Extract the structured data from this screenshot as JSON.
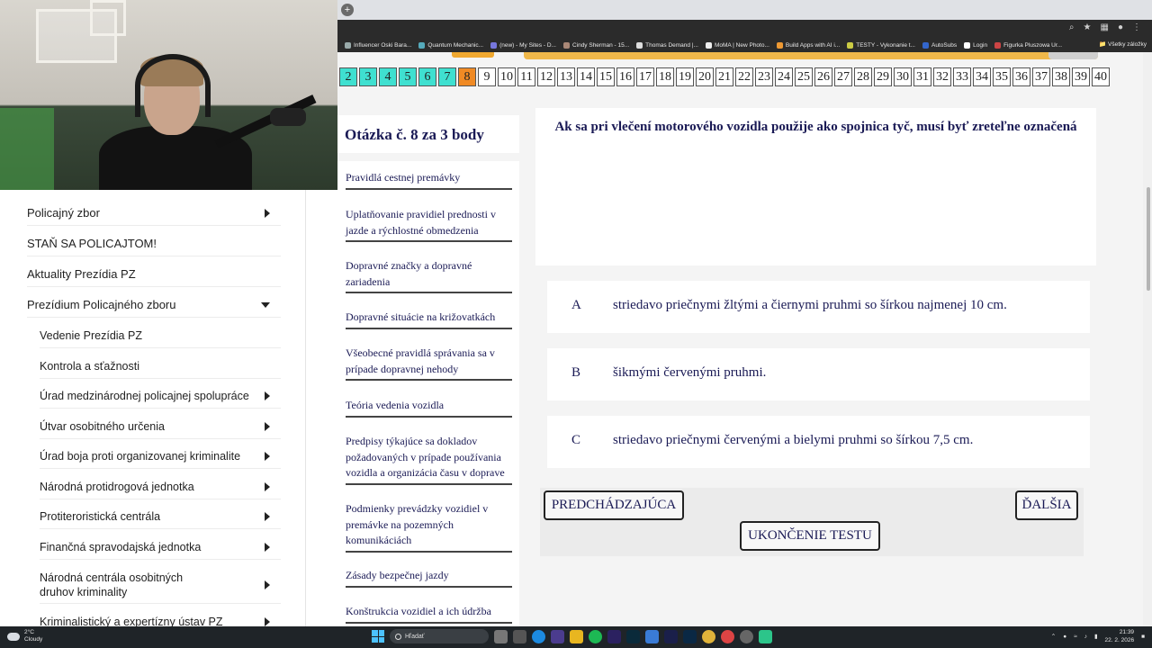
{
  "sidebar": {
    "items": [
      {
        "label": "Policajný zbor",
        "arrow": "right"
      },
      {
        "label": "STAŇ SA POLICAJTOM!",
        "arrow": ""
      },
      {
        "label": "Aktuality Prezídia PZ",
        "arrow": ""
      },
      {
        "label": "Prezídium Policajného zboru",
        "arrow": "down"
      },
      {
        "label": "Vedenie Prezídia PZ",
        "arrow": ""
      },
      {
        "label": "Kontrola a sťažnosti",
        "arrow": ""
      },
      {
        "label": "Úrad medzinárodnej policajnej spolupráce",
        "arrow": "right"
      },
      {
        "label": "Útvar osobitného určenia",
        "arrow": "right"
      },
      {
        "label": "Úrad boja proti organizovanej kriminalite",
        "arrow": "right"
      },
      {
        "label": "Národná protidrogová jednotka",
        "arrow": "right"
      },
      {
        "label": "Protiteroristická centrála",
        "arrow": "right"
      },
      {
        "label": "Finančná spravodajská jednotka",
        "arrow": "right"
      },
      {
        "label": "Národná centrála osobitných druhov kriminality",
        "arrow": "right"
      },
      {
        "label": "Kriminalistický a expertízny ústav PZ",
        "arrow": "right"
      }
    ]
  },
  "browser": {
    "bookmarks": [
      "Influencer Oski Bara...",
      "Quantum Mechanic...",
      "(new) - My Sites - D...",
      "Cindy Sherman - 15...",
      "Thomas Demand |...",
      "MoMA | New Photo...",
      "Build Apps with AI i...",
      "TESTY - Vykonanie t...",
      "AutoSubs",
      "Login",
      "Figurka Pluszowa Ur..."
    ],
    "bookmarks_all": "Všetky záložky"
  },
  "quiz": {
    "question_numbers": [
      "2",
      "3",
      "4",
      "5",
      "6",
      "7",
      "8",
      "9",
      "10",
      "11",
      "12",
      "13",
      "14",
      "15",
      "16",
      "17",
      "18",
      "19",
      "20",
      "21",
      "22",
      "23",
      "24",
      "25",
      "26",
      "27",
      "28",
      "29",
      "30",
      "31",
      "32",
      "33",
      "34",
      "35",
      "36",
      "37",
      "38",
      "39",
      "40"
    ],
    "done_up_to": "7",
    "current": "8",
    "question_title": "Otázka č. 8 za 3 body",
    "categories": [
      "Pravidlá cestnej premávky",
      "Uplatňovanie pravidiel prednosti v jazde a rýchlostné obmedzenia",
      "Dopravné značky a dopravné zariadenia",
      "Dopravné situácie na križovatkách",
      "Všeobecné pravidlá správania sa v prípade dopravnej nehody",
      "Teória vedenia vozidla",
      "Predpisy týkajúce sa dokladov požadovaných v prípade používania vozidla a organizácia času v doprave",
      "Podmienky prevádzky vozidiel v premávke na pozemných komunikáciách",
      "Zásady bezpečnej jazdy",
      "Konštrukcia vozidiel a ich údržba"
    ],
    "question_text": "Ak sa pri vlečení motorového vozidla použije ako spojnica tyč, musí byť zreteľne označená",
    "answers": [
      {
        "letter": "A",
        "text": "striedavo priečnymi žltými a čiernymi pruhmi so šírkou najmenej 10 cm."
      },
      {
        "letter": "B",
        "text": "šikmými červenými pruhmi."
      },
      {
        "letter": "C",
        "text": "striedavo priečnymi červenými a bielymi pruhmi so šírkou 7,5 cm."
      }
    ],
    "prev_label": "PREDCHÁDZAJÚCA",
    "next_label": "ĎALŠIA",
    "finish_label": "UKONČENIE TESTU"
  },
  "taskbar": {
    "weather_temp": "2°C",
    "weather_desc": "Cloudy",
    "search_placeholder": "Hľadať",
    "time": "21:39",
    "date": "22. 2. 2026"
  },
  "colors": {
    "quiz_text": "#1a1a55",
    "done": "#3fe0d0",
    "current": "#f08a24"
  }
}
